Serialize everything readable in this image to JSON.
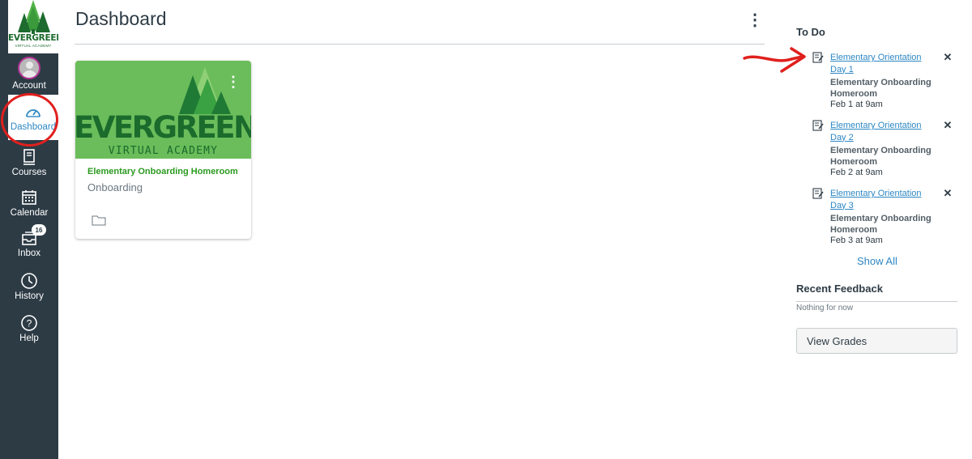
{
  "brand": {
    "logo_word": "EVERGREEN",
    "logo_sub": "VIRTUAL ACADEMY",
    "nav_bg": "#2d3b45",
    "link_color": "#2d87c3",
    "annotation_color": "#e0201d"
  },
  "global_nav": {
    "items": [
      {
        "label": "Account",
        "icon": "avatar"
      },
      {
        "label": "Dashboard",
        "icon": "dashboard-gauge-icon"
      },
      {
        "label": "Courses",
        "icon": "courses-book-icon"
      },
      {
        "label": "Calendar",
        "icon": "calendar-icon"
      },
      {
        "label": "Inbox",
        "icon": "inbox-icon",
        "badge": "16"
      },
      {
        "label": "History",
        "icon": "history-clock-icon"
      },
      {
        "label": "Help",
        "icon": "help-question-icon"
      }
    ]
  },
  "main": {
    "title": "Dashboard",
    "card": {
      "hero_word": "EVERGREEN",
      "hero_sub": "VIRTUAL ACADEMY",
      "title": "Elementary Onboarding Homeroom",
      "subtitle": "Onboarding",
      "hero_color": "#6bbd5b"
    }
  },
  "sidebar": {
    "todo_heading": "To Do",
    "todo_items": [
      {
        "title": "Elementary Orientation Day 1",
        "context": "Elementary Onboarding Homeroom",
        "date": "Feb 1 at 9am"
      },
      {
        "title": "Elementary Orientation Day 2",
        "context": "Elementary Onboarding Homeroom",
        "date": "Feb 2 at 9am"
      },
      {
        "title": "Elementary Orientation Day 3",
        "context": "Elementary Onboarding Homeroom",
        "date": "Feb 3 at 9am"
      }
    ],
    "show_all": "Show All",
    "feedback_heading": "Recent Feedback",
    "feedback_empty": "Nothing for now",
    "view_grades": "View Grades"
  }
}
